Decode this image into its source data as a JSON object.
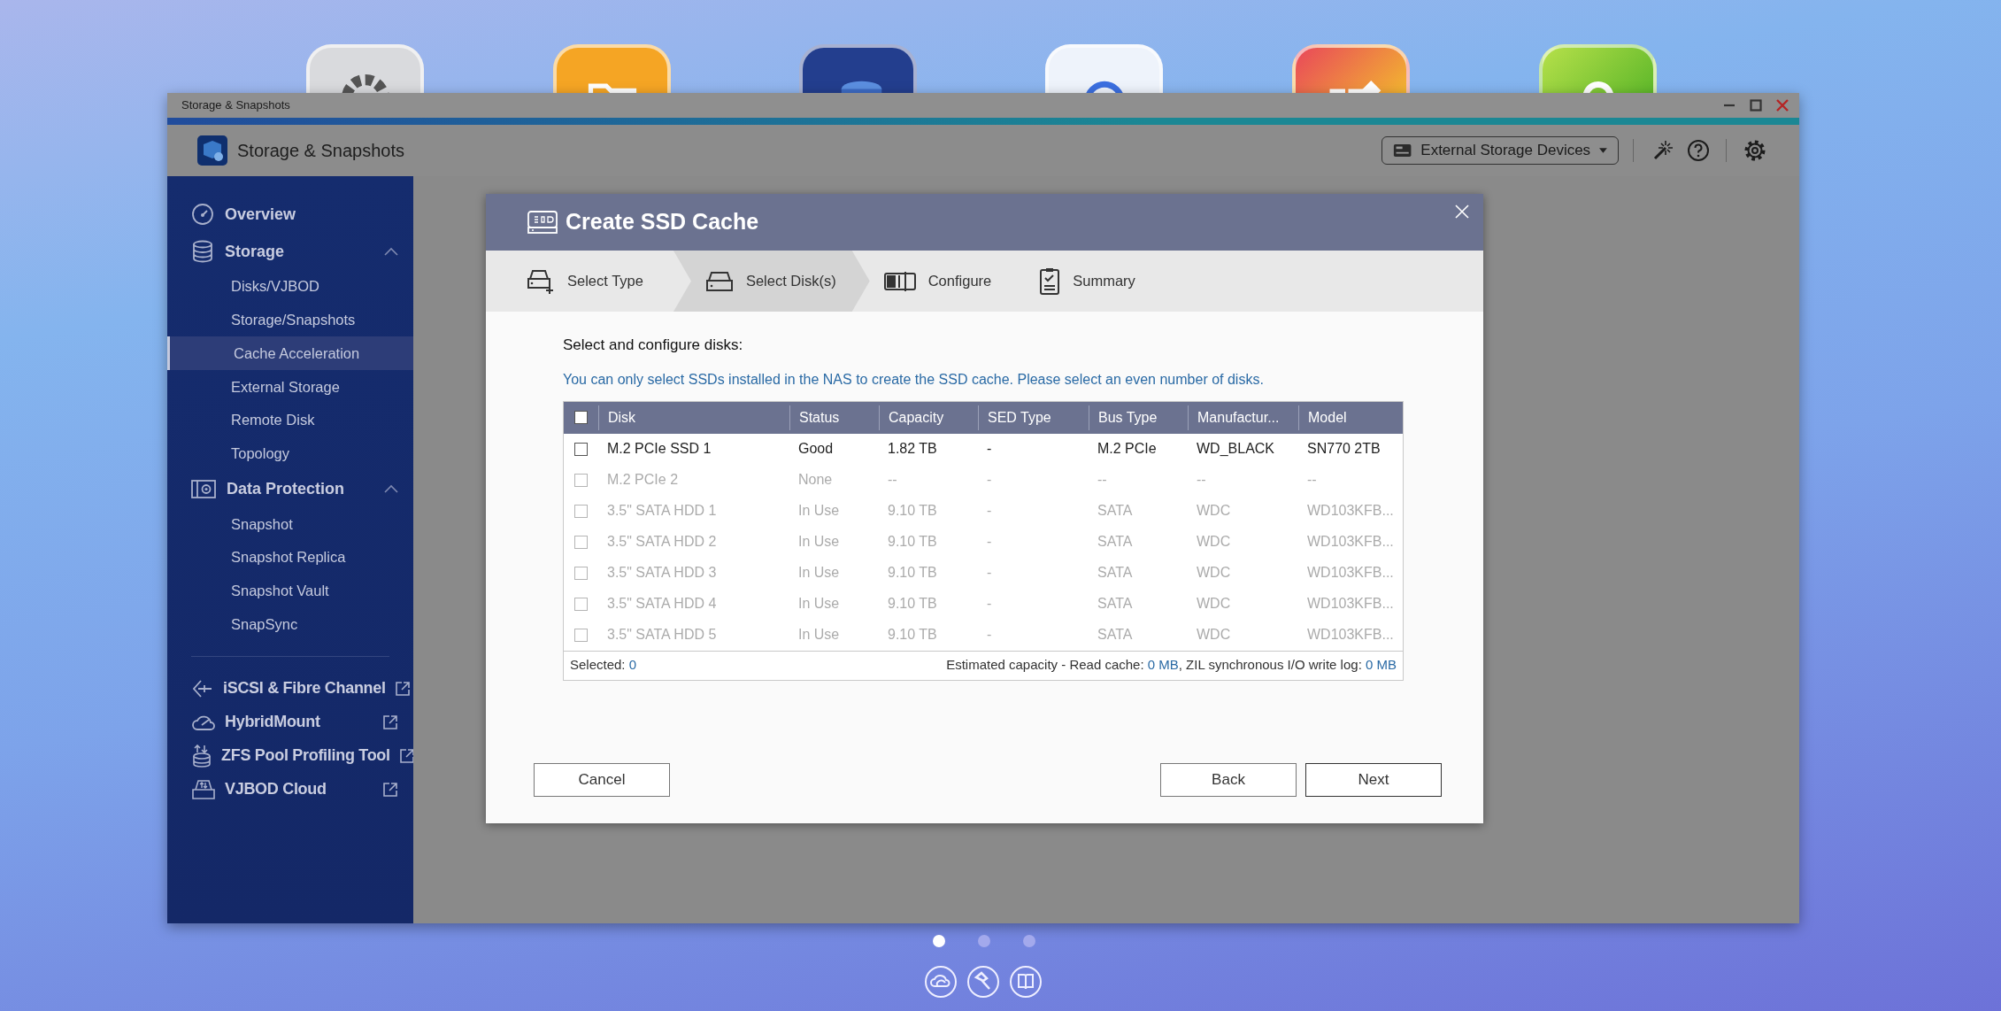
{
  "desktop": {
    "page_dots": [
      {
        "selected": true
      },
      {
        "selected": false
      },
      {
        "selected": false
      }
    ]
  },
  "window": {
    "title": "Storage & Snapshots",
    "app_title": "Storage & Snapshots",
    "device_dropdown": "External Storage Devices"
  },
  "sidebar": {
    "items": [
      {
        "kind": "link",
        "label": "Overview"
      },
      {
        "kind": "group",
        "label": "Storage",
        "expanded": true,
        "children": [
          {
            "label": "Disks/VJBOD",
            "selected": false
          },
          {
            "label": "Storage/Snapshots",
            "selected": false
          },
          {
            "label": "Cache Acceleration",
            "selected": true
          },
          {
            "label": "External Storage",
            "selected": false
          },
          {
            "label": "Remote Disk",
            "selected": false
          },
          {
            "label": "Topology",
            "selected": false
          }
        ]
      },
      {
        "kind": "group",
        "label": "Data Protection",
        "expanded": true,
        "children": [
          {
            "label": "Snapshot",
            "selected": false
          },
          {
            "label": "Snapshot Replica",
            "selected": false
          },
          {
            "label": "Snapshot Vault",
            "selected": false
          },
          {
            "label": "SnapSync",
            "selected": false
          }
        ]
      }
    ],
    "external_links": [
      {
        "label": "iSCSI & Fibre Channel"
      },
      {
        "label": "HybridMount"
      },
      {
        "label": "ZFS Pool Profiling Tool"
      },
      {
        "label": "VJBOD Cloud"
      }
    ]
  },
  "dialog": {
    "title": "Create SSD Cache",
    "steps": [
      {
        "label": "Select Type",
        "selected": false
      },
      {
        "label": "Select Disk(s)",
        "selected": true
      },
      {
        "label": "Configure",
        "selected": false
      },
      {
        "label": "Summary",
        "selected": false
      }
    ],
    "heading": "Select and configure disks:",
    "info": "You can only select SSDs installed in the NAS to create the SSD cache. Please select an even number of disks.",
    "table": {
      "select_all_checked": false,
      "columns": [
        "Disk",
        "Status",
        "Capacity",
        "SED Type",
        "Bus Type",
        "Manufactur...",
        "Model"
      ],
      "rows": [
        {
          "checked": false,
          "disabled": false,
          "cells": [
            "M.2 PCIe SSD 1",
            "Good",
            "1.82 TB",
            "-",
            "M.2 PCIe",
            "WD_BLACK",
            "SN770 2TB"
          ]
        },
        {
          "checked": false,
          "disabled": true,
          "cells": [
            "M.2 PCIe 2",
            "None",
            "--",
            "-",
            "--",
            "--",
            "--"
          ]
        },
        {
          "checked": false,
          "disabled": true,
          "cells": [
            "3.5\" SATA HDD 1",
            "In Use",
            "9.10 TB",
            "-",
            "SATA",
            "WDC",
            "WD103KFB..."
          ]
        },
        {
          "checked": false,
          "disabled": true,
          "cells": [
            "3.5\" SATA HDD 2",
            "In Use",
            "9.10 TB",
            "-",
            "SATA",
            "WDC",
            "WD103KFB..."
          ]
        },
        {
          "checked": false,
          "disabled": true,
          "cells": [
            "3.5\" SATA HDD 3",
            "In Use",
            "9.10 TB",
            "-",
            "SATA",
            "WDC",
            "WD103KFB..."
          ]
        },
        {
          "checked": false,
          "disabled": true,
          "cells": [
            "3.5\" SATA HDD 4",
            "In Use",
            "9.10 TB",
            "-",
            "SATA",
            "WDC",
            "WD103KFB..."
          ]
        },
        {
          "checked": false,
          "disabled": true,
          "cells": [
            "3.5\" SATA HDD 5",
            "In Use",
            "9.10 TB",
            "-",
            "SATA",
            "WDC",
            "WD103KFB..."
          ]
        }
      ],
      "footer": {
        "selected": [
          {
            "kind": "label",
            "text": "Selected: "
          },
          {
            "kind": "value",
            "text": "0"
          }
        ],
        "capacity": [
          {
            "kind": "label",
            "text": "Estimated capacity - Read cache: "
          },
          {
            "kind": "value",
            "text": "0 MB"
          },
          {
            "kind": "label",
            "text": ", ZIL synchronous I/O write log: "
          },
          {
            "kind": "value",
            "text": "0 MB"
          }
        ]
      }
    },
    "buttons": {
      "cancel": "Cancel",
      "back": "Back",
      "next": "Next"
    }
  }
}
